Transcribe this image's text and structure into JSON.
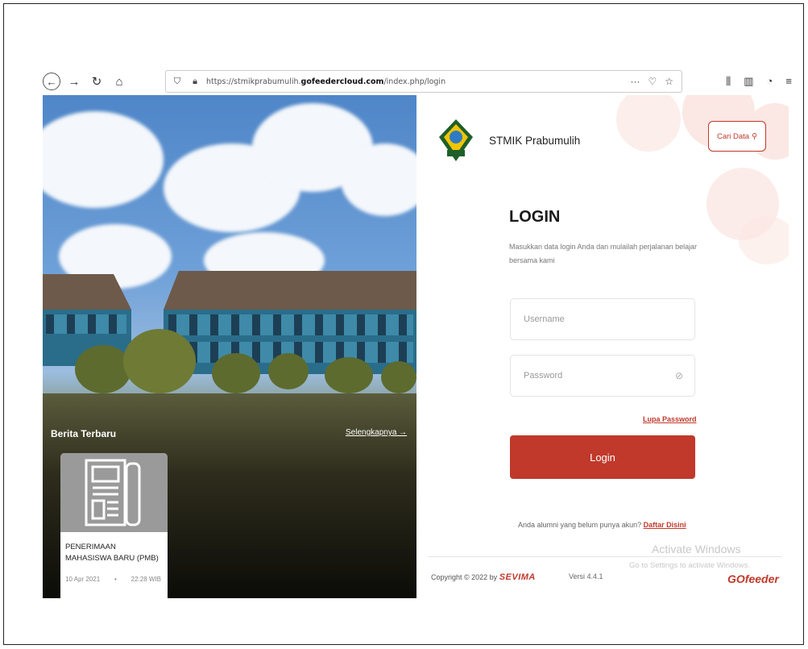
{
  "browser": {
    "url_prefix": "https://stmikprabumulih.",
    "url_domain": "gofeedercloud.com",
    "url_path": "/index.php/login"
  },
  "hero": {
    "news_title": "Berita Terbaru",
    "news_more": "Selengkapnya →",
    "card": {
      "title": "PENERIMAAN MAHASISWA BARU (PMB)",
      "date": "10 Apr 2021",
      "time": "22:28 WIB"
    }
  },
  "header": {
    "brand_name": "STMIK Prabumulih",
    "cari_label": "Cari Data"
  },
  "login": {
    "heading": "LOGIN",
    "subtitle": "Masukkan data login Anda dan mulailah perjalanan belajar bersama kami",
    "username_placeholder": "Username",
    "password_placeholder": "Password",
    "lupa_label": "Lupa Password",
    "button_label": "Login",
    "alumni_text": "Anda alumni yang belum punya akun?",
    "alumni_link": "Daftar Disini"
  },
  "footer": {
    "copyright": "Copyright © 2022 by",
    "sevima": "SEVIMA",
    "versi": "Versi 4.4.1",
    "gofeeder": "GOfeeder"
  },
  "overlay": {
    "activate_title": "Activate Windows",
    "activate_sub": "Go to Settings to activate Windows."
  },
  "colors": {
    "accent": "#c0392b",
    "deco": "#fbe7e3"
  }
}
